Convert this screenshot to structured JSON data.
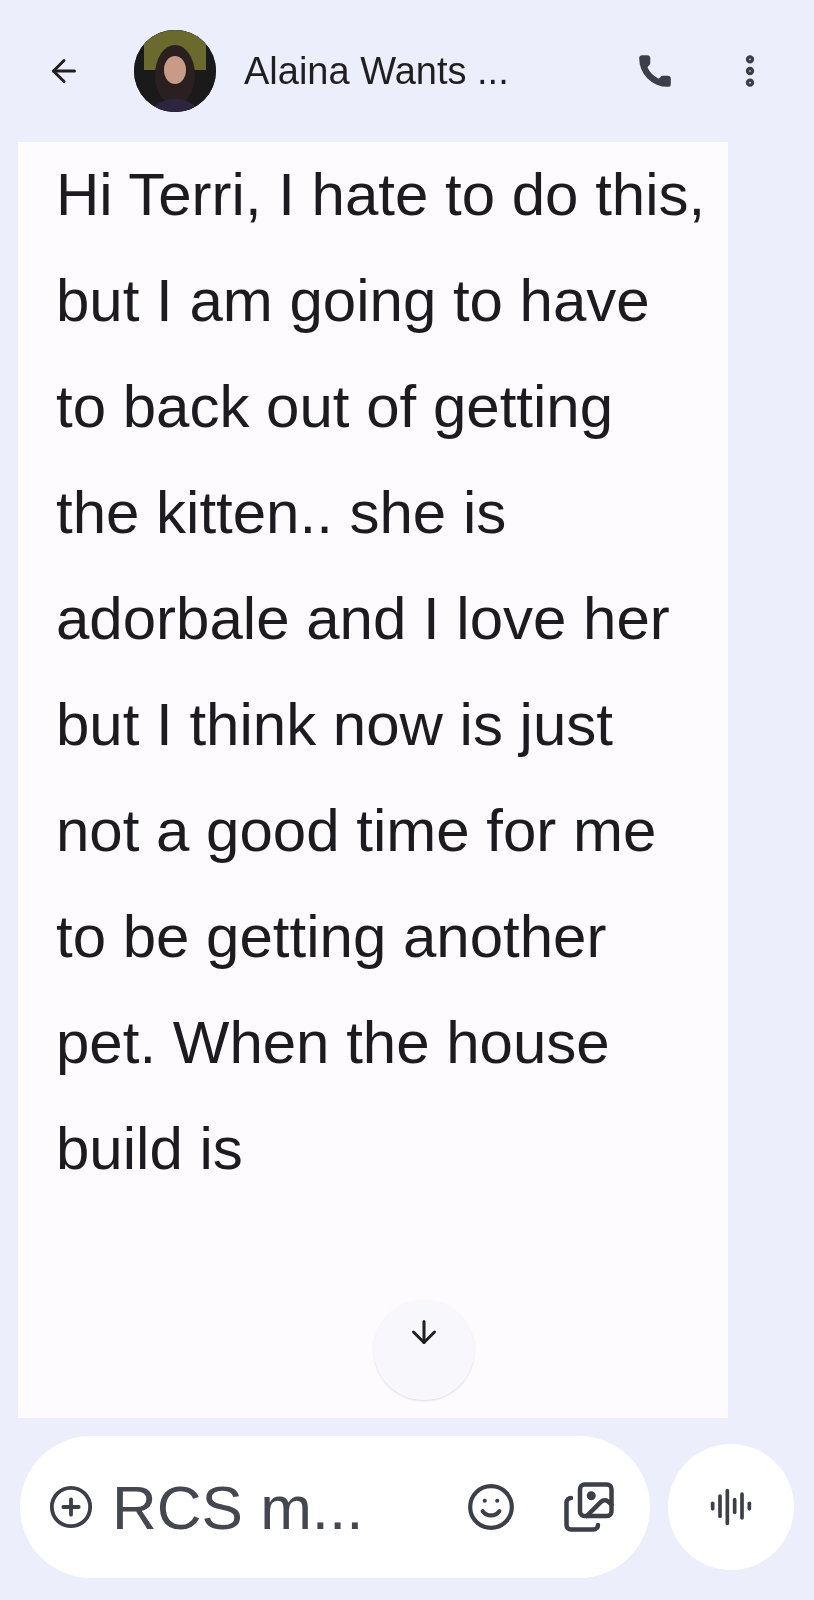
{
  "header": {
    "title": "Alaina Wants ..."
  },
  "message": {
    "text": "Hi Terri, I hate to do this, but I am going to have to back out of getting the kitten.. she is adorbale and I love her but I think now is just not a good time for me to be getting another pet. When the house build is"
  },
  "composer": {
    "placeholder": "RCS m..."
  }
}
